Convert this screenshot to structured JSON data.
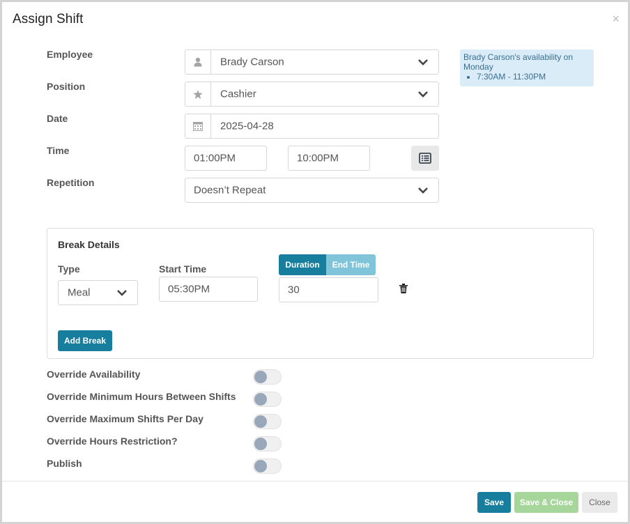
{
  "dialog": {
    "title": "Assign Shift",
    "close_glyph": "×"
  },
  "form": {
    "employee": {
      "label": "Employee",
      "value": "Brady Carson",
      "icon": "user-icon"
    },
    "position": {
      "label": "Position",
      "value": "Cashier",
      "icon": "star-icon"
    },
    "date": {
      "label": "Date",
      "value": "2025-04-28",
      "icon": "calendar-icon"
    },
    "time": {
      "label": "Time",
      "start": "01:00PM",
      "end": "10:00PM"
    },
    "repetition": {
      "label": "Repetition",
      "value": "Doesn’t Repeat"
    }
  },
  "availability": {
    "heading": "Brady Carson's availability on Monday",
    "items": [
      "7:30AM - 11:30PM"
    ]
  },
  "break_details": {
    "title": "Break Details",
    "type_label": "Type",
    "type_value": "Meal",
    "start_label": "Start Time",
    "start_value": "05:30PM",
    "mode_duration": "Duration",
    "mode_end_time": "End Time",
    "duration_value": "30",
    "add_label": "Add Break"
  },
  "toggles": [
    {
      "label": "Override Availability",
      "on": false
    },
    {
      "label": "Override Minimum Hours Between Shifts",
      "on": false
    },
    {
      "label": "Override Maximum Shifts Per Day",
      "on": false
    },
    {
      "label": "Override Hours Restriction?",
      "on": false
    },
    {
      "label": "Publish",
      "on": false
    }
  ],
  "footer": {
    "save": "Save",
    "save_close": "Save & Close",
    "close": "Close"
  },
  "colors": {
    "primary": "#177f9d",
    "success_light": "#a6d69a",
    "info_bg": "#d9ecf7",
    "toggle_knob": "#98a7ba"
  }
}
